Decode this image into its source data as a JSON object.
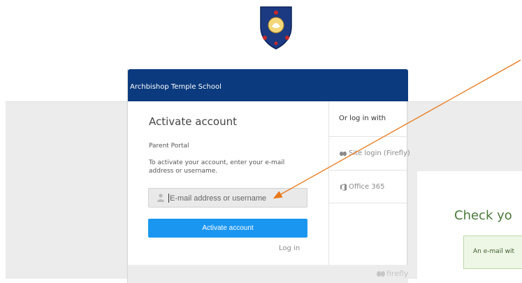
{
  "header": {
    "school_name": "Archbishop Temple School",
    "crest_icon": "school-crest-icon"
  },
  "activate_form": {
    "title": "Activate account",
    "portal_label": "Parent Portal",
    "instructions": "To activate your account, enter your e-mail address or username.",
    "email_placeholder": "E-mail address or username",
    "submit_label": "Activate account",
    "login_link": "Log in"
  },
  "sso": {
    "heading": "Or log in with",
    "providers": [
      {
        "label": "Site login (Firefly)",
        "icon": "firefly-icon"
      },
      {
        "label": "Office 365",
        "icon": "office-365-icon"
      }
    ]
  },
  "footer": {
    "brand": "firefly",
    "brand_icon": "firefly-logo-icon"
  },
  "background_panel": {
    "title_fragment": "Check yo",
    "notice_fragment": "An e-mail wit"
  },
  "annotation": {
    "arrow_color": "#e8781a"
  },
  "colors": {
    "header_bg": "#0b3a7e",
    "button_bg": "#1a96f0",
    "confirm_green": "#4a7a3a"
  }
}
